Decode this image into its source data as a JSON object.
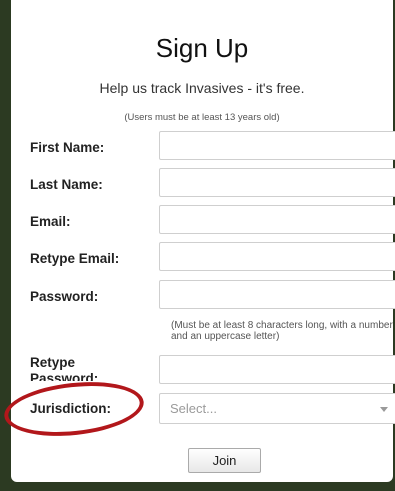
{
  "page": {
    "title": "Sign Up",
    "subtitle": "Help us track Invasives - it's free.",
    "age_note": "(Users must be at least 13 years old)"
  },
  "fields": {
    "first_name": "First Name:",
    "last_name": "Last Name:",
    "email": "Email:",
    "retype_email": "Retype Email:",
    "password": "Password:",
    "password_note": "(Must be at least 8 characters long, with a number and an uppercase letter)",
    "retype_password": "Retype Password:",
    "jurisdiction": "Jurisdiction:",
    "jurisdiction_placeholder": "Select..."
  },
  "actions": {
    "join": "Join"
  },
  "colors": {
    "frame": "#2c3a22",
    "highlight_circle": "#b2171b"
  }
}
